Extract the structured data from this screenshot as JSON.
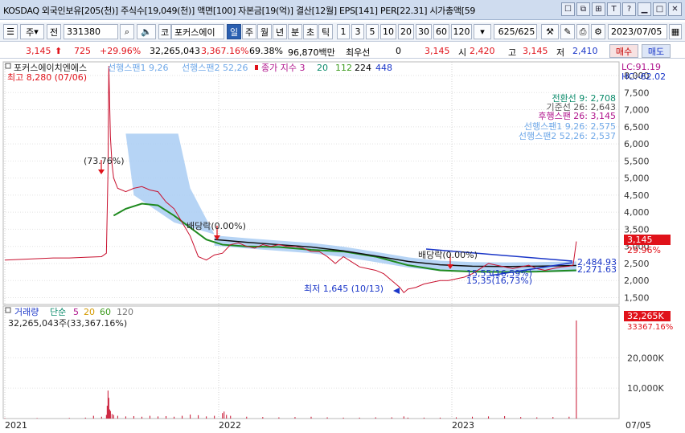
{
  "window": {
    "title": "KOSDAQ 외국인보유[205(천)] 주식수[19,049(천)] 액면[100] 자본금[19(억)] 결산[12월] EPS[141] PER[22.31] 시가총액[59",
    "buttons": [
      "☐",
      "⧉",
      "⊞",
      "T",
      "?",
      "▁",
      "□",
      "✕"
    ]
  },
  "toolbar": {
    "market": "주",
    "ref": "전",
    "code": "331380",
    "kospi_kosdaq": "코",
    "stock_name": "포커스에이",
    "periods": [
      "일",
      "주",
      "월",
      "년",
      "분",
      "초",
      "틱"
    ],
    "selected_period": "일",
    "intervals": [
      "1",
      "3",
      "5",
      "10",
      "20",
      "30",
      "60",
      "120"
    ],
    "count": "625/625",
    "date": "2023/07/05"
  },
  "pricebar": {
    "price": "3,145",
    "change": "725",
    "change_pct": "+29.96%",
    "volume": "32,265,043",
    "volume_pct": "3,367.16%",
    "turnover_pct": "69.38%",
    "trade_value": "96,870백만",
    "preferred_label": "최우선",
    "preferred_value": "0",
    "ask_price": "3,145",
    "open_label": "시",
    "open": "2,420",
    "high_label": "고",
    "high": "3,145",
    "low_label": "저",
    "low": "2,410",
    "buy": "매수",
    "sell": "매도"
  },
  "chart_data": {
    "type": "line",
    "stock": "포커스에이치엔에스",
    "price_axis": {
      "ylim": [
        1300,
        8400
      ],
      "ticks": [
        1500,
        2000,
        2500,
        3000,
        3500,
        4000,
        4500,
        5000,
        5500,
        6000,
        6500,
        7000,
        7500,
        8000
      ],
      "tick_labels": [
        "1,500",
        "2,000",
        "2,500",
        "3,000",
        "3,500",
        "4,000",
        "4,500",
        "5,000",
        "5,500",
        "6,000",
        "6,500",
        "7,000",
        "7,500",
        "8,000"
      ]
    },
    "x_labels": [
      "2021",
      "2022",
      "2023",
      "07/05"
    ],
    "legend_top": {
      "name": "포커스에이치엔에스",
      "cloud1": "선행스팬1 9,26",
      "cloud2": "선행스팬2 52,26",
      "close_ma": "종가 지수 3",
      "ma_periods": [
        "20",
        "112",
        "224",
        "448"
      ]
    },
    "lc_hc": [
      "LC:91.19",
      "HC:-62.02"
    ],
    "ichimoku_labels": [
      {
        "text": "전환선 9: 2,708",
        "color": "#0a8a6a"
      },
      {
        "text": "기준선 26: 2,643",
        "color": "#555555"
      },
      {
        "text": "후행스팬 26: 3,145",
        "color": "#b0148c"
      },
      {
        "text": "선행스팬1 9,26: 2,575",
        "color": "#6fa8e8"
      },
      {
        "text": "선행스팬2 52,26: 2,537",
        "color": "#6fa8e8"
      }
    ],
    "annotations": {
      "high": "최고 8,280 (07/06)",
      "low": "최저 1,645 (10/13)",
      "pct1": "(73.76%)",
      "div1": "배당락(0.00%)",
      "div2": "배당락(0.00%)",
      "trend1": "2,484.93",
      "trend2": "2,271.63",
      "fib_a": "15,55(16,59%)",
      "fib_b": "15,35(16,73%)",
      "current_price": "3,145",
      "current_pct": "29.96%"
    },
    "price_series": [
      [
        0,
        2600
      ],
      [
        20,
        2620
      ],
      [
        40,
        2640
      ],
      [
        60,
        2660
      ],
      [
        80,
        2660
      ],
      [
        100,
        2680
      ],
      [
        120,
        2700
      ],
      [
        126,
        2800
      ],
      [
        128,
        5200
      ],
      [
        129,
        8280
      ],
      [
        131,
        6200
      ],
      [
        133,
        5400
      ],
      [
        135,
        5000
      ],
      [
        140,
        4700
      ],
      [
        150,
        4600
      ],
      [
        160,
        4700
      ],
      [
        170,
        4750
      ],
      [
        180,
        4650
      ],
      [
        190,
        4600
      ],
      [
        200,
        4300
      ],
      [
        210,
        4100
      ],
      [
        220,
        3700
      ],
      [
        230,
        3300
      ],
      [
        240,
        2700
      ],
      [
        250,
        2600
      ],
      [
        260,
        2750
      ],
      [
        270,
        2800
      ],
      [
        280,
        3050
      ],
      [
        290,
        3100
      ],
      [
        300,
        3000
      ],
      [
        310,
        2950
      ],
      [
        320,
        3050
      ],
      [
        330,
        3000
      ],
      [
        340,
        3050
      ],
      [
        350,
        3000
      ],
      [
        360,
        3000
      ],
      [
        370,
        2950
      ],
      [
        380,
        2850
      ],
      [
        390,
        2850
      ],
      [
        400,
        2700
      ],
      [
        410,
        2500
      ],
      [
        420,
        2700
      ],
      [
        430,
        2550
      ],
      [
        440,
        2400
      ],
      [
        450,
        2350
      ],
      [
        460,
        2300
      ],
      [
        470,
        2200
      ],
      [
        480,
        2000
      ],
      [
        490,
        1800
      ],
      [
        495,
        1645
      ],
      [
        500,
        1750
      ],
      [
        510,
        1800
      ],
      [
        520,
        1900
      ],
      [
        530,
        1950
      ],
      [
        540,
        2000
      ],
      [
        550,
        2000
      ],
      [
        560,
        2050
      ],
      [
        570,
        2100
      ],
      [
        580,
        2200
      ],
      [
        590,
        2350
      ],
      [
        600,
        2500
      ],
      [
        610,
        2450
      ],
      [
        620,
        2400
      ],
      [
        630,
        2350
      ],
      [
        640,
        2400
      ],
      [
        650,
        2450
      ],
      [
        660,
        2350
      ],
      [
        670,
        2300
      ],
      [
        680,
        2350
      ],
      [
        690,
        2400
      ],
      [
        700,
        2420
      ],
      [
        705,
        2450
      ],
      [
        709,
        3145
      ]
    ],
    "ma_long_series": [
      [
        260,
        3200
      ],
      [
        300,
        3120
      ],
      [
        340,
        3050
      ],
      [
        380,
        2980
      ],
      [
        420,
        2870
      ],
      [
        460,
        2720
      ],
      [
        500,
        2560
      ],
      [
        540,
        2460
      ],
      [
        580,
        2420
      ],
      [
        620,
        2410
      ],
      [
        660,
        2420
      ],
      [
        709,
        2440
      ]
    ],
    "ma_green_series": [
      [
        135,
        3900
      ],
      [
        150,
        4100
      ],
      [
        170,
        4250
      ],
      [
        190,
        4200
      ],
      [
        210,
        3900
      ],
      [
        230,
        3550
      ],
      [
        250,
        3200
      ],
      [
        270,
        3050
      ],
      [
        300,
        3000
      ],
      [
        340,
        2980
      ],
      [
        380,
        2900
      ],
      [
        420,
        2850
      ],
      [
        460,
        2700
      ],
      [
        500,
        2450
      ],
      [
        540,
        2300
      ],
      [
        580,
        2260
      ],
      [
        620,
        2250
      ],
      [
        660,
        2260
      ],
      [
        709,
        2300
      ]
    ],
    "volume_panel": {
      "legend": "거래량",
      "ma_label": "단순",
      "ma_periods": [
        "5",
        "20",
        "60",
        "120"
      ],
      "current": "32,265,043주(33,367.16%)",
      "axis_labels": [
        "10,000K",
        "20,000K"
      ],
      "axis_ticks": [
        10000,
        20000
      ],
      "ylim": [
        0,
        37000
      ],
      "current_k": "32,265K",
      "current_pct": "33367.16%",
      "bars": [
        [
          0,
          120
        ],
        [
          40,
          150
        ],
        [
          80,
          200
        ],
        [
          100,
          300
        ],
        [
          110,
          900
        ],
        [
          120,
          600
        ],
        [
          126,
          1200
        ],
        [
          127,
          4200
        ],
        [
          128,
          9200
        ],
        [
          129,
          6800
        ],
        [
          130,
          3000
        ],
        [
          131,
          2500
        ],
        [
          133,
          1500
        ],
        [
          135,
          1200
        ],
        [
          140,
          900
        ],
        [
          150,
          700
        ],
        [
          160,
          800
        ],
        [
          170,
          600
        ],
        [
          180,
          900
        ],
        [
          190,
          700
        ],
        [
          200,
          800
        ],
        [
          210,
          600
        ],
        [
          220,
          900
        ],
        [
          230,
          1300
        ],
        [
          240,
          1100
        ],
        [
          250,
          700
        ],
        [
          260,
          900
        ],
        [
          270,
          1800
        ],
        [
          272,
          2300
        ],
        [
          275,
          1200
        ],
        [
          280,
          900
        ],
        [
          300,
          600
        ],
        [
          320,
          500
        ],
        [
          340,
          400
        ],
        [
          360,
          500
        ],
        [
          380,
          600
        ],
        [
          400,
          400
        ],
        [
          420,
          300
        ],
        [
          440,
          300
        ],
        [
          460,
          400
        ],
        [
          480,
          400
        ],
        [
          495,
          700
        ],
        [
          500,
          300
        ],
        [
          520,
          300
        ],
        [
          540,
          300
        ],
        [
          560,
          400
        ],
        [
          580,
          600
        ],
        [
          600,
          700
        ],
        [
          620,
          800
        ],
        [
          640,
          500
        ],
        [
          660,
          400
        ],
        [
          680,
          500
        ],
        [
          700,
          600
        ],
        [
          709,
          32265
        ]
      ]
    }
  }
}
